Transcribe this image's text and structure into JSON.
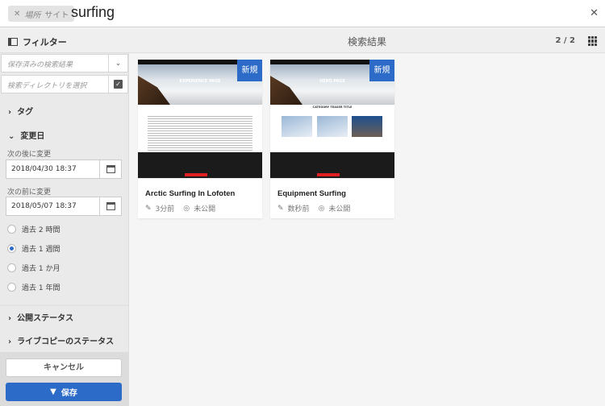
{
  "search": {
    "scope_tag_label": "場所",
    "scope_tag_value": "サイト",
    "query": "surfing",
    "close_icon": "close-icon"
  },
  "header": {
    "filter_label": "フィルター",
    "title": "検索結果",
    "count": "2 / 2"
  },
  "sidebar": {
    "saved_search_placeholder": "保存済みの検索結果",
    "directory_placeholder": "検索ディレクトリを選択",
    "tags_label": "タグ",
    "modified_label": "変更日",
    "after_label": "次の後に変更",
    "after_value": "2018/04/30 18:37",
    "before_label": "次の前に変更",
    "before_value": "2018/05/07 18:37",
    "ranges": [
      {
        "label": "過去 2 時間",
        "selected": false
      },
      {
        "label": "過去 1 週間",
        "selected": true
      },
      {
        "label": "過去 1 か月",
        "selected": false
      },
      {
        "label": "過去 1 年間",
        "selected": false
      }
    ],
    "publish_status_label": "公開ステータス",
    "livecopy_status_label": "ライブコピーのステータス",
    "cancel_label": "キャンセル",
    "save_label": "保存"
  },
  "results": [
    {
      "title": "Arctic Surfing In Lofoten",
      "badge": "新規",
      "modified": "3分前",
      "status": "未公開",
      "thumb_heading": "EXPERIENCE PAGE"
    },
    {
      "title": "Equipment Surfing",
      "badge": "新規",
      "modified": "数秒前",
      "status": "未公開",
      "thumb_heading": "HERO PAGE",
      "thumb_subheading": "CATEGORY TEASER TITLE"
    }
  ],
  "colors": {
    "accent": "#2d6bc9",
    "sidebar": "#eaeaea",
    "footer_red": "#e02020"
  }
}
